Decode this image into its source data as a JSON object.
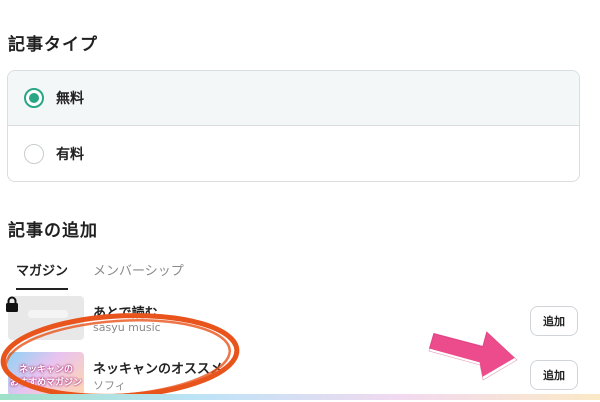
{
  "article_type": {
    "title": "記事タイプ",
    "options": [
      {
        "label": "無料",
        "selected": true
      },
      {
        "label": "有料",
        "selected": false
      }
    ]
  },
  "add_section": {
    "title": "記事の追加",
    "tabs": [
      {
        "label": "マガジン",
        "active": true
      },
      {
        "label": "メンバーシップ",
        "active": false
      }
    ],
    "items": [
      {
        "title": "あとで読む",
        "author": "sasyu music",
        "locked": true,
        "button": "追加",
        "thumbnail": "plain"
      },
      {
        "title": "ネッキャンのオススメ",
        "author": "ソフィ",
        "locked": false,
        "button": "追加",
        "thumbnail": "art",
        "thumbnail_text": [
          "ネッキャンの",
          "おすすめマガジン"
        ]
      }
    ]
  },
  "colors": {
    "accent": "#2aa585",
    "annotation_circle": "#e8541c",
    "annotation_arrow": "#ec4c8c"
  },
  "icons": [
    "lock-icon",
    "radio-checked",
    "radio-unchecked"
  ]
}
